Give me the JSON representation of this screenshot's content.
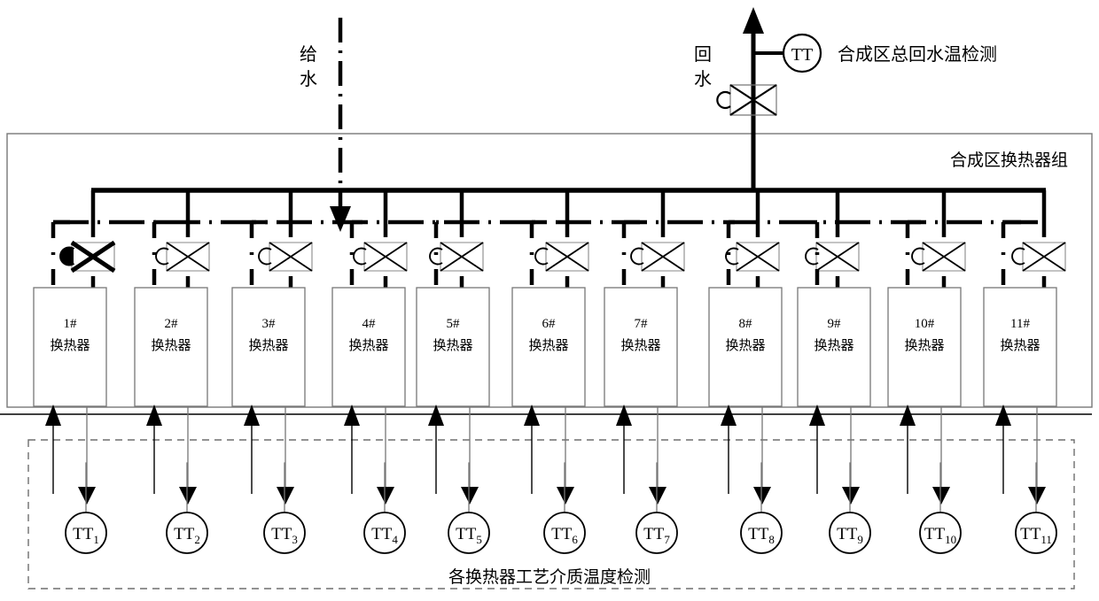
{
  "diagram": {
    "title_supply": "给\n水",
    "supply_label_line1": "给",
    "supply_label_line2": "水",
    "return_label_line1": "回",
    "return_label_line2": "水",
    "main_return_tt": "TT",
    "main_return_tt_caption": "合成区总回水温检测",
    "group_box_label": "合成区换热器组",
    "sensor_box_caption": "各换热器工艺介质温度检测",
    "exchanger_suffix": "换热器",
    "tt_prefix": "TT",
    "colors": {
      "line": "#000000",
      "box_stroke": "#666666",
      "thin_stroke": "#808080",
      "dashed_stroke": "#888888",
      "background": "#ffffff"
    },
    "exchangers": [
      {
        "id": 1,
        "number": "1#",
        "name": "换热器",
        "tt": "TT",
        "tt_sub": "1",
        "valve_highlighted": true
      },
      {
        "id": 2,
        "number": "2#",
        "name": "换热器",
        "tt": "TT",
        "tt_sub": "2",
        "valve_highlighted": false
      },
      {
        "id": 3,
        "number": "3#",
        "name": "换热器",
        "tt": "TT",
        "tt_sub": "3",
        "valve_highlighted": false
      },
      {
        "id": 4,
        "number": "4#",
        "name": "换热器",
        "tt": "TT",
        "tt_sub": "4",
        "valve_highlighted": false
      },
      {
        "id": 5,
        "number": "5#",
        "name": "换热器",
        "tt": "TT",
        "tt_sub": "5",
        "valve_highlighted": false
      },
      {
        "id": 6,
        "number": "6#",
        "name": "换热器",
        "tt": "TT",
        "tt_sub": "6",
        "valve_highlighted": false
      },
      {
        "id": 7,
        "number": "7#",
        "name": "换热器",
        "tt": "TT",
        "tt_sub": "7",
        "valve_highlighted": false
      },
      {
        "id": 8,
        "number": "8#",
        "name": "换热器",
        "tt": "TT",
        "tt_sub": "8",
        "valve_highlighted": false
      },
      {
        "id": 9,
        "number": "9#",
        "name": "换热器",
        "tt": "TT",
        "tt_sub": "9",
        "valve_highlighted": false
      },
      {
        "id": 10,
        "number": "10#",
        "name": "换热器",
        "tt": "TT",
        "tt_sub": "10",
        "valve_highlighted": false
      },
      {
        "id": 11,
        "number": "11#",
        "name": "换热器",
        "tt": "TT",
        "tt_sub": "11",
        "valve_highlighted": false
      }
    ]
  }
}
